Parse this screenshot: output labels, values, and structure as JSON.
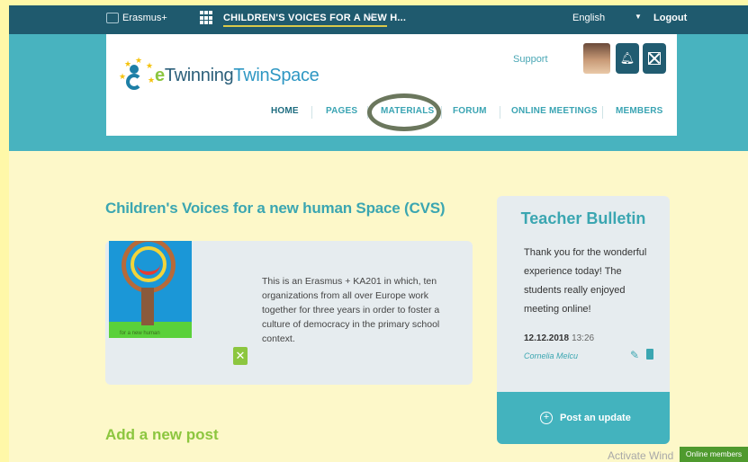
{
  "topbar": {
    "erasmus": "Erasmus+",
    "project": "CHILDREN'S VOICES FOR A NEW H...",
    "chevron": "∨",
    "language": "English",
    "language_arrow": "▼",
    "logout": "Logout"
  },
  "header": {
    "logo_e": "e",
    "logo_main": "Twinning",
    "logo_twin": "TwinSpace",
    "support": "Support",
    "nav": {
      "home": "HOME",
      "pages": "PAGES",
      "materials": "MATERIALS",
      "forum": "FORUM",
      "online_meetings": "ONLINE MEETINGS",
      "members": "MEMBERS"
    }
  },
  "main": {
    "title": "Children's Voices for a new human Space (CVS)",
    "thumb_caption": "for a new human",
    "description": "This is an Erasmus + KA201 in which, ten organizations from all over Europe work together for three years in order to foster a culture of democracy in the primary school context.",
    "add_post": "Add a new post"
  },
  "bulletin": {
    "title": "Teacher Bulletin",
    "message": "Thank you for the wonderful experience today! The students really enjoyed meeting online!",
    "date": "12.12.2018",
    "time": "13:26",
    "author": "Cornelia Melcu",
    "post_update": "Post an update"
  },
  "overlay": {
    "watermark": "Activate Wind",
    "online_members": "Online members"
  },
  "colors": {
    "topbar": "#1f5a6e",
    "band": "#48b3bf",
    "accent_teal": "#3ba6b1",
    "accent_green": "#8cc63f"
  }
}
